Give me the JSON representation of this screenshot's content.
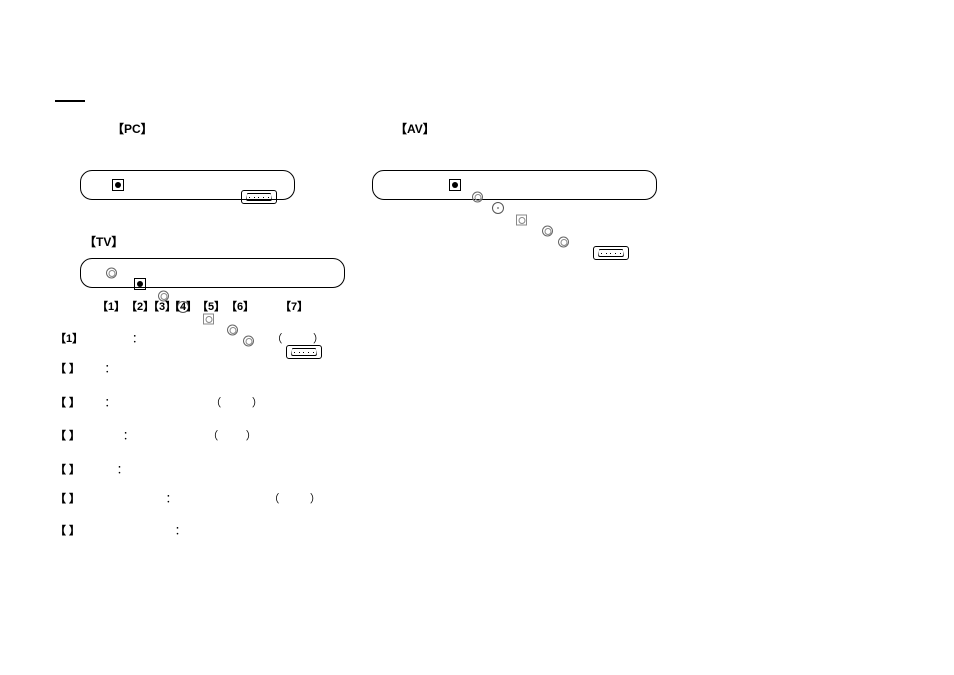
{
  "labels": {
    "pc": "【PC】",
    "av": "【AV】",
    "tv": "【TV】"
  },
  "port_nums": {
    "n1": "【1】",
    "n2": "【2】",
    "n3": "【3】",
    "n4": "【4】",
    "n5": "【5】",
    "n6": "【6】",
    "n7": "【7】"
  },
  "desc": {
    "r1": {
      "num": "【1】",
      "rest": "                ：                                          （          ）"
    },
    "r2": {
      "num": "【    】",
      "rest": "        ："
    },
    "r3": {
      "num": "【    】",
      "rest": "        ：                               （          ）"
    },
    "r4": {
      "num": "【    】",
      "rest": "              ：                        （         ）"
    },
    "r5": {
      "num": "【    】",
      "rest": "            ："
    },
    "r6": {
      "num": "【    】",
      "rest": "                            ：                              （          ）"
    },
    "r7": {
      "num": "【    】",
      "rest": "                               ："
    }
  }
}
